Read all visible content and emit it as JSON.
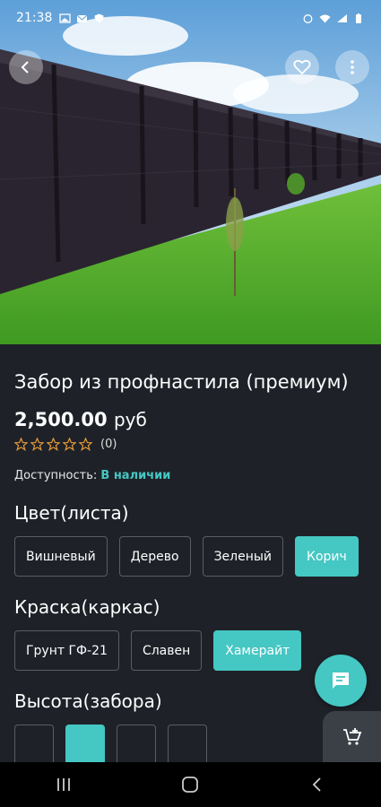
{
  "status_bar": {
    "time": "21:38"
  },
  "product": {
    "title": "Забор из профнастила (премиум)",
    "price_value": "2,500.00",
    "price_currency": "руб",
    "rating_stars": 0,
    "rating_count": "(0)",
    "availability_label": "Доступность:",
    "availability_value": "В наличии"
  },
  "options": {
    "color": {
      "title": "Цвет(листа)",
      "items": [
        "Вишневый",
        "Дерево",
        "Зеленый",
        "Корич"
      ],
      "selected": "Корич"
    },
    "paint": {
      "title": "Краска(каркас)",
      "items": [
        "Грунт ГФ-21",
        "Славен",
        "Хамерайт"
      ],
      "selected": "Хамерайт"
    },
    "height": {
      "title": "Высота(забора)"
    }
  },
  "colors": {
    "accent": "#45c7c3",
    "background": "#1e2228",
    "star": "#e89a3c"
  },
  "icons": [
    "back-icon",
    "heart-icon",
    "more-vertical-icon",
    "chat-icon",
    "add-to-cart-icon",
    "recents-icon",
    "home-icon",
    "nav-back-icon"
  ]
}
